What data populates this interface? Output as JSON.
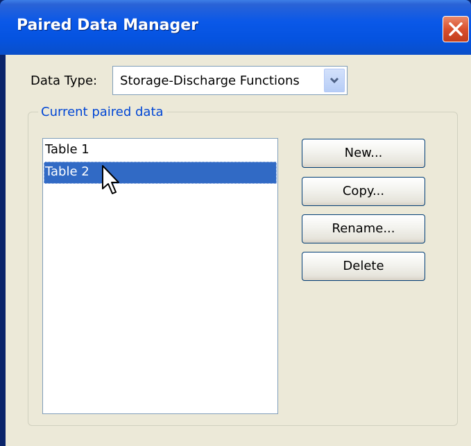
{
  "window": {
    "title": "Paired Data Manager"
  },
  "data_type": {
    "label": "Data Type:",
    "value": "Storage-Discharge Functions"
  },
  "group": {
    "label": "Current paired data"
  },
  "list": {
    "items": [
      {
        "label": "Table 1",
        "selected": false
      },
      {
        "label": "Table 2",
        "selected": true
      }
    ]
  },
  "buttons": {
    "new": "New...",
    "copy": "Copy...",
    "rename": "Rename...",
    "delete": "Delete"
  },
  "icons": {
    "close": "close-icon",
    "dropdown": "chevron-down-icon",
    "cursor": "mouse-pointer-icon"
  },
  "colors": {
    "titlebar": "#0553e0",
    "client": "#ece9d8",
    "selection": "#316ac5",
    "close_button": "#d9502d",
    "group_label": "#0046d5"
  }
}
